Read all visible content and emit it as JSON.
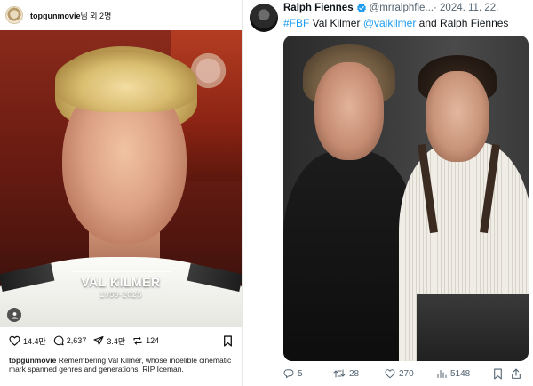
{
  "instagram": {
    "username": "topgunmovie",
    "header_suffix": "님 외 2명",
    "photo_title": "VAL KILMER",
    "photo_years": "1959-2025",
    "likes": "14.4만",
    "comments": "2,637",
    "shares": "3.4만",
    "reposts": "124",
    "caption_user": "topgunmovie",
    "caption_text": " Remembering Val Kilmer, whose indelible cinematic mark spanned genres and generations. RIP Iceman."
  },
  "tweet": {
    "display_name": "Ralph Fiennes",
    "handle": "@mrralphfie...",
    "date": " · 2024. 11. 22.",
    "hashtag": "#FBF",
    "text_1": " Val Kilmer ",
    "mention": "@valkilmer",
    "text_2": " and Ralph Fiennes",
    "replies": "5",
    "retweets": "28",
    "likes": "270",
    "views": "5148",
    "accent": "#1d9bf0"
  }
}
